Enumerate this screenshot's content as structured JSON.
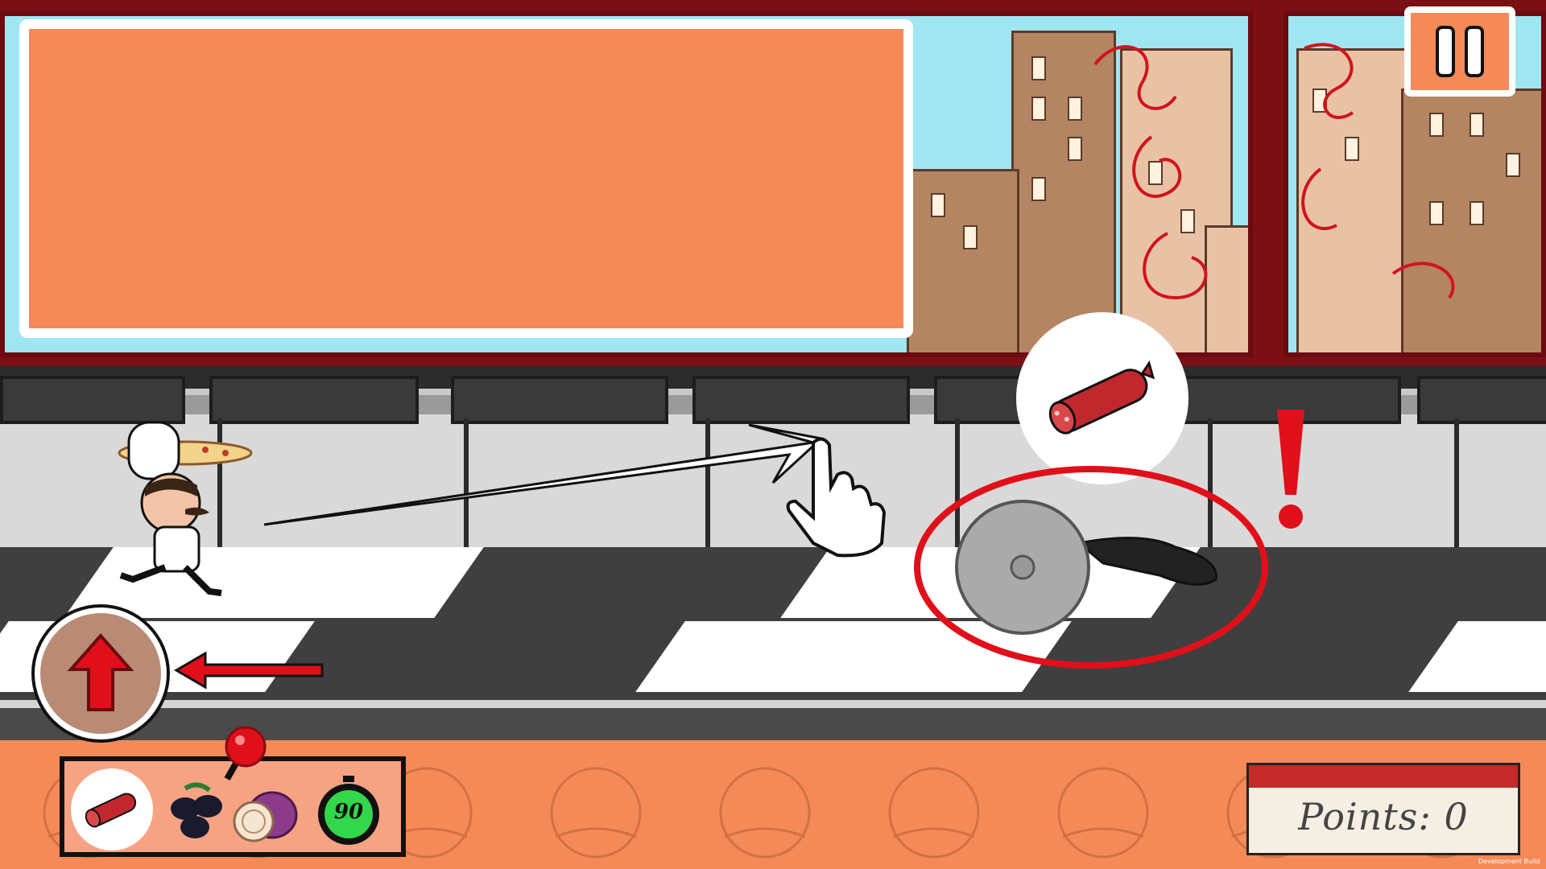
{
  "hud": {
    "points_label": "Points: 0",
    "timer_value": "90",
    "development_build_label": "Development Build"
  },
  "ingredients": [
    {
      "name": "salami",
      "selected": true
    },
    {
      "name": "olives",
      "selected": false
    },
    {
      "name": "onion",
      "selected": false
    }
  ],
  "tutorial": {
    "target_ingredient_icon": "salami-icon",
    "hazard": "pizza-cutter",
    "warning_mark": "!"
  },
  "colors": {
    "panel_orange": "#f48a57",
    "wall_red": "#7a0f14",
    "warning_red": "#e0101a",
    "sky": "#9fe6f2"
  }
}
